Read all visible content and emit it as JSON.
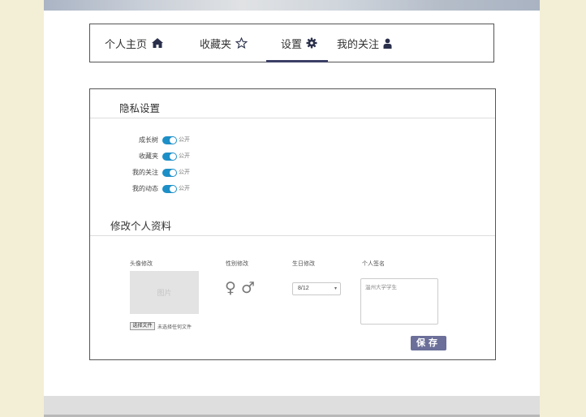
{
  "nav": {
    "items": [
      {
        "label": "个人主页",
        "icon": "home-icon"
      },
      {
        "label": "收藏夹",
        "icon": "star-outline-icon"
      },
      {
        "label": "设置",
        "icon": "gear-icon",
        "active": true
      },
      {
        "label": "我的关注",
        "icon": "user-icon"
      }
    ]
  },
  "privacy": {
    "title": "隐私设置",
    "rows": [
      {
        "label": "成长树",
        "status": "公开"
      },
      {
        "label": "收藏夹",
        "status": "公开"
      },
      {
        "label": "我的关注",
        "status": "公开"
      },
      {
        "label": "我的动态",
        "status": "公开"
      }
    ]
  },
  "profile": {
    "title": "修改个人资料",
    "avatar_label": "头像修改",
    "avatar_placeholder": "图片",
    "file_button": "选择文件",
    "file_status": "未选择任何文件",
    "gender_label": "性别修改",
    "gender_female": "♀",
    "gender_male": "♂",
    "birthday_label": "生日修改",
    "birthday_value": "8/12",
    "birthday_arrow": "▾",
    "signature_label": "个人签名",
    "signature_placeholder": "温州大学学生",
    "save_label": "保存"
  },
  "colors": {
    "accent": "#3b3f66",
    "toggle_on": "#1d8fc7",
    "save_button": "#6b6f99"
  }
}
